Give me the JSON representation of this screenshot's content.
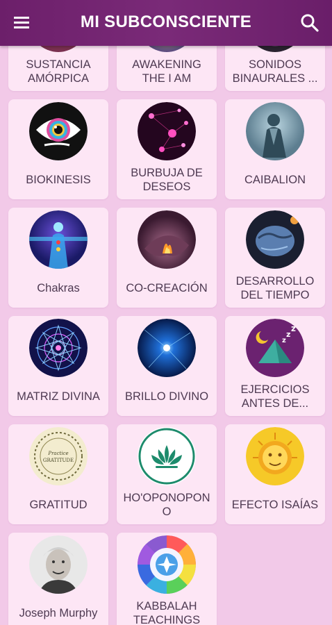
{
  "app": {
    "title": "MI SUBCONSCIENTE"
  },
  "icons": {
    "menu": "hamburger-menu-icon",
    "search": "search-icon"
  },
  "colors": {
    "appbar": "#6c1f6a",
    "background": "#f2c9e8",
    "card": "#fde6f5",
    "label_text": "#4e3a52"
  },
  "items": [
    {
      "label": "SUSTANCIA\nAMÓRPICA"
    },
    {
      "label": "AWAKENING\nTHE I AM"
    },
    {
      "label": "SONIDOS\nBINAURALES ..."
    },
    {
      "label": "BIOKINESIS"
    },
    {
      "label": "BURBUJA DE\nDESEOS"
    },
    {
      "label": "CAIBALION"
    },
    {
      "label": "Chakras"
    },
    {
      "label": "CO-CREACIÓN"
    },
    {
      "label": "DESARROLLO\nDEL TIEMPO"
    },
    {
      "label": "MATRIZ DIVINA"
    },
    {
      "label": "BRILLO DIVINO"
    },
    {
      "label": "EJERCICIOS\nANTES DE..."
    },
    {
      "label": "GRATITUD",
      "badge_text": "Practice GRATITUDE"
    },
    {
      "label": "HO'OPONOPON\nO"
    },
    {
      "label": "EFECTO ISAÍAS"
    },
    {
      "label": "Joseph Murphy"
    },
    {
      "label": "KABBALAH\nTEACHINGS"
    }
  ]
}
